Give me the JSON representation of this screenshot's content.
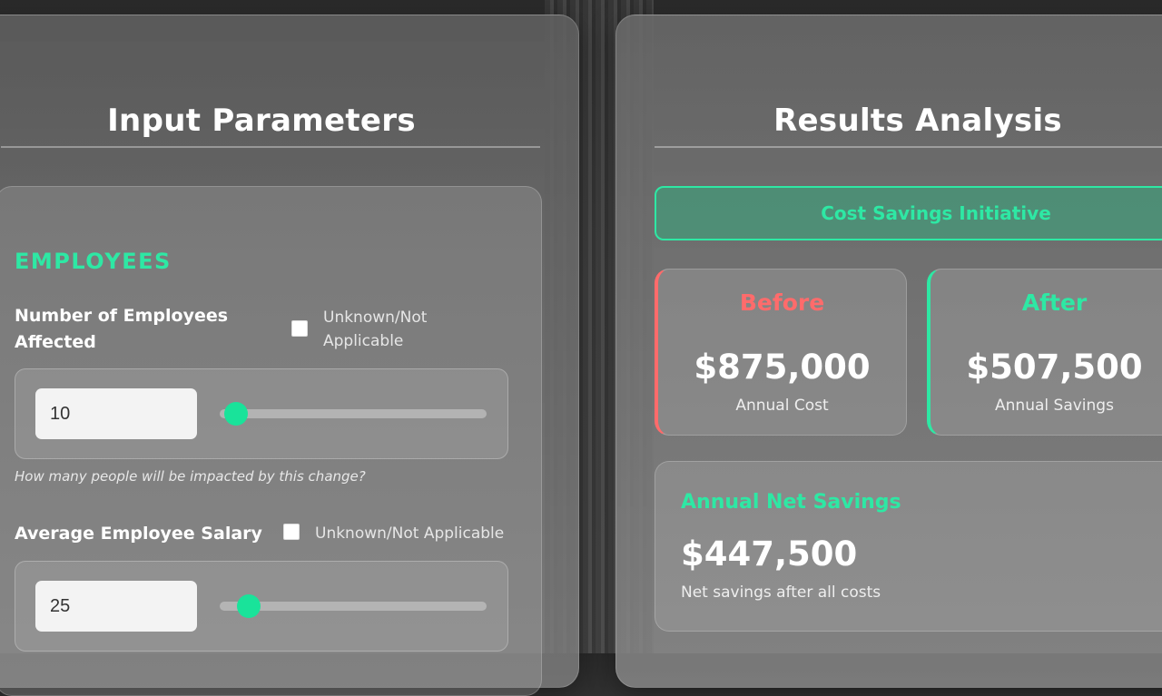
{
  "input_panel": {
    "title": "Input Parameters",
    "section_label": "EMPLOYEES",
    "fields": [
      {
        "label_line1": "Number of Employees",
        "label_line2": "Affected",
        "checkbox_label_line1": "Unknown/Not",
        "checkbox_label_line2": "Applicable",
        "value": "10",
        "slider_fraction": 0.06,
        "helper": "How many people will be impacted by this change?"
      },
      {
        "label": "Average Employee Salary",
        "checkbox_label": "Unknown/Not Applicable",
        "value": "25",
        "slider_fraction": 0.11
      }
    ]
  },
  "results_panel": {
    "title": "Results Analysis",
    "banner": "Cost Savings Initiative",
    "before": {
      "heading": "Before",
      "value": "$875,000",
      "caption": "Annual Cost"
    },
    "after": {
      "heading": "After",
      "value": "$507,500",
      "caption": "Annual Savings"
    },
    "net": {
      "title": "Annual Net Savings",
      "value": "$447,500",
      "caption": "Net savings after all costs"
    }
  },
  "colors": {
    "accent": "#2ee8a4",
    "slider": "#19e39a",
    "negative": "#ff6b6b"
  },
  "icons": {
    "checkbox": "checkbox-empty"
  }
}
